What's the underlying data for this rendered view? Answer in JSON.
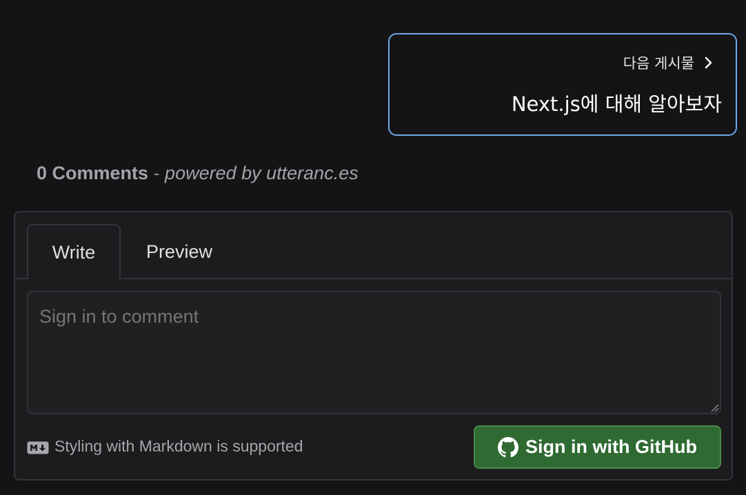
{
  "next_post": {
    "label": "다음 게시물",
    "title": "Next.js에 대해 알아보자"
  },
  "comments": {
    "count_label": "0 Comments",
    "separator": " - ",
    "powered_by": "powered by utteranc.es"
  },
  "editor": {
    "tabs": [
      {
        "label": "Write",
        "active": true
      },
      {
        "label": "Preview",
        "active": false
      }
    ],
    "placeholder": "Sign in to comment",
    "markdown_note": "Styling with Markdown is supported",
    "signin_label": "Sign in with GitHub"
  },
  "colors": {
    "background": "#141416",
    "card_border": "#6fa8e6",
    "button_green": "#2f6a33"
  },
  "icons": {
    "next_chevron": "chevron-right-icon",
    "markdown": "markdown-icon",
    "github": "github-icon",
    "resize": "resize-handle-icon"
  }
}
